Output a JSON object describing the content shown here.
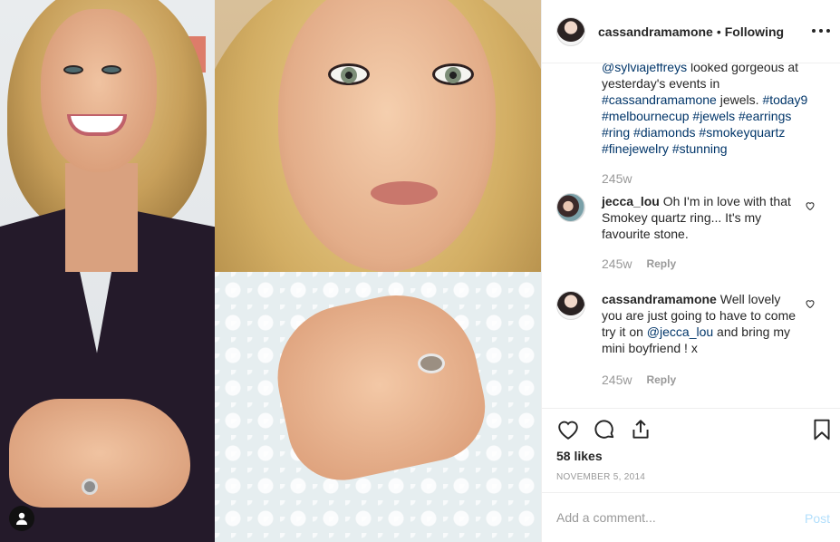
{
  "post": {
    "username": "cassandramamone",
    "separator": "•",
    "follow_status": "Following",
    "caption": {
      "parts": [
        {
          "text": "@sylviajeffreys",
          "tag": true
        },
        {
          "text": " looked gorgeous at yesterday's events in ",
          "tag": false
        },
        {
          "text": "#cassandramamone",
          "tag": true
        },
        {
          "text": " jewels. ",
          "tag": false
        },
        {
          "text": "#today9",
          "tag": true
        },
        {
          "text": " ",
          "tag": false
        },
        {
          "text": "#melbournecup",
          "tag": true
        },
        {
          "text": " ",
          "tag": false
        },
        {
          "text": "#jewels",
          "tag": true
        },
        {
          "text": " ",
          "tag": false
        },
        {
          "text": "#earrings",
          "tag": true
        },
        {
          "text": " ",
          "tag": false
        },
        {
          "text": "#ring",
          "tag": true
        },
        {
          "text": " ",
          "tag": false
        },
        {
          "text": "#diamonds",
          "tag": true
        },
        {
          "text": " ",
          "tag": false
        },
        {
          "text": "#smokeyquartz",
          "tag": true
        },
        {
          "text": " ",
          "tag": false
        },
        {
          "text": "#finejewelry",
          "tag": true
        },
        {
          "text": " ",
          "tag": false
        },
        {
          "text": "#stunning",
          "tag": true
        }
      ],
      "time": "245w"
    },
    "comments": [
      {
        "username": "jecca_lou",
        "text_parts": [
          {
            "text": "Oh I'm in love with that Smokey quartz ring... It's my favourite stone.",
            "tag": false
          }
        ],
        "time": "245w",
        "reply_label": "Reply"
      },
      {
        "username": "cassandramamone",
        "text_parts": [
          {
            "text": "Well lovely you are just going to have to come try it on ",
            "tag": false
          },
          {
            "text": "@jecca_lou",
            "tag": true
          },
          {
            "text": " and bring my mini boyfriend ! x",
            "tag": false
          }
        ],
        "time": "245w",
        "reply_label": "Reply"
      }
    ],
    "likes": "58 likes",
    "date": "NOVEMBER 5, 2014",
    "add_comment_placeholder": "Add a comment...",
    "post_button": "Post"
  },
  "colors": {
    "hashtag": "#003569",
    "muted": "#999999",
    "post_button_disabled": "#b2dffc"
  },
  "icons": [
    "user-tag-icon",
    "more-options-icon",
    "heart-icon",
    "comment-icon",
    "share-icon",
    "bookmark-icon"
  ]
}
